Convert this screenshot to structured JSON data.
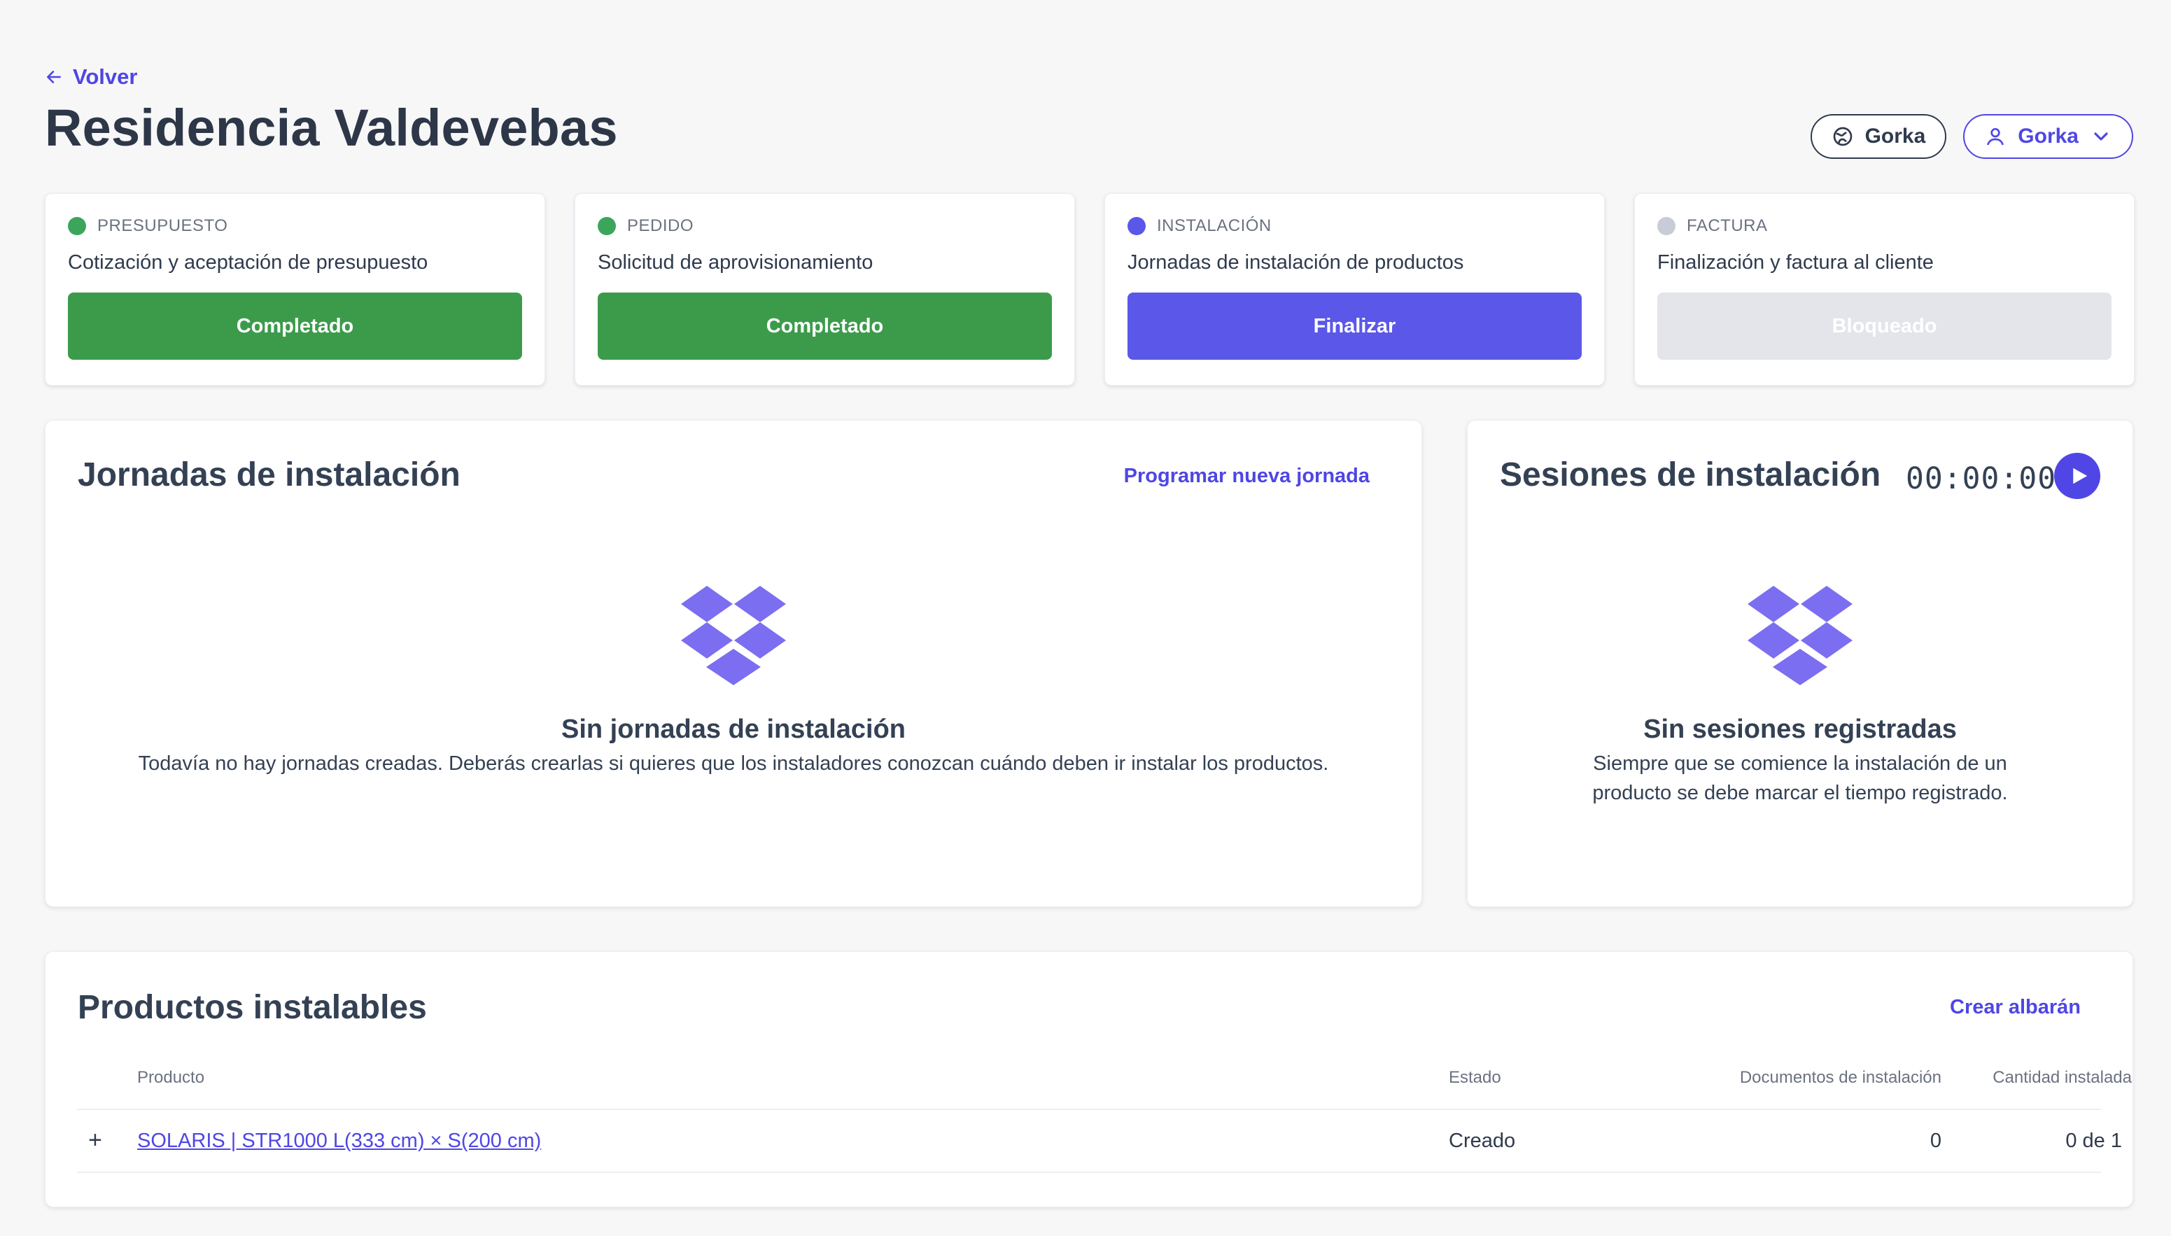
{
  "header": {
    "back_label": "Volver",
    "title": "Residencia Valdevebas",
    "org_button_label": "Gorka",
    "user_button_label": "Gorka"
  },
  "steps": [
    {
      "label": "PRESUPUESTO",
      "description": "Cotización y aceptación de presupuesto",
      "button": "Completado",
      "dot_color": "#3ba55c",
      "button_color": "#3b9b4a",
      "button_text_color": "#ffffff"
    },
    {
      "label": "PEDIDO",
      "description": "Solicitud de aprovisionamiento",
      "button": "Completado",
      "dot_color": "#3ba55c",
      "button_color": "#3b9b4a",
      "button_text_color": "#ffffff"
    },
    {
      "label": "INSTALACIÓN",
      "description": "Jornadas de instalación de productos",
      "button": "Finalizar",
      "dot_color": "#5b57e8",
      "button_color": "#5b57e8",
      "button_text_color": "#ffffff"
    },
    {
      "label": "FACTURA",
      "description": "Finalización y factura al cliente",
      "button": "Bloqueado",
      "dot_color": "#c7ccd6",
      "button_color": "#e3e5ea",
      "button_text_color": "#ffffff"
    }
  ],
  "jornadas": {
    "title": "Jornadas de instalación",
    "action": "Programar nueva jornada",
    "empty_title": "Sin jornadas de instalación",
    "empty_text": "Todavía no hay jornadas creadas. Deberás crearlas si quieres que los instaladores conozcan cuándo deben ir instalar los productos."
  },
  "sesiones": {
    "title": "Sesiones de instalación",
    "timer": "00:00:00",
    "empty_title": "Sin sesiones registradas",
    "empty_text_line1": "Siempre que se comience la instalación de un",
    "empty_text_line2": "producto se debe marcar el tiempo registrado."
  },
  "productos": {
    "title": "Productos instalables",
    "action": "Crear albarán",
    "columns": [
      "Producto",
      "Estado",
      "Documentos de instalación",
      "Cantidad instalada"
    ],
    "rows": [
      {
        "expander": "+",
        "producto": "SOLARIS | STR1000 L(333 cm) × S(200 cm)",
        "estado": "Creado",
        "documentos": "0",
        "cantidad": "0 de 1"
      }
    ]
  },
  "colors": {
    "accent": "#4f46e5",
    "success": "#3b9b4a",
    "icon_purple": "#7b6ef0"
  }
}
